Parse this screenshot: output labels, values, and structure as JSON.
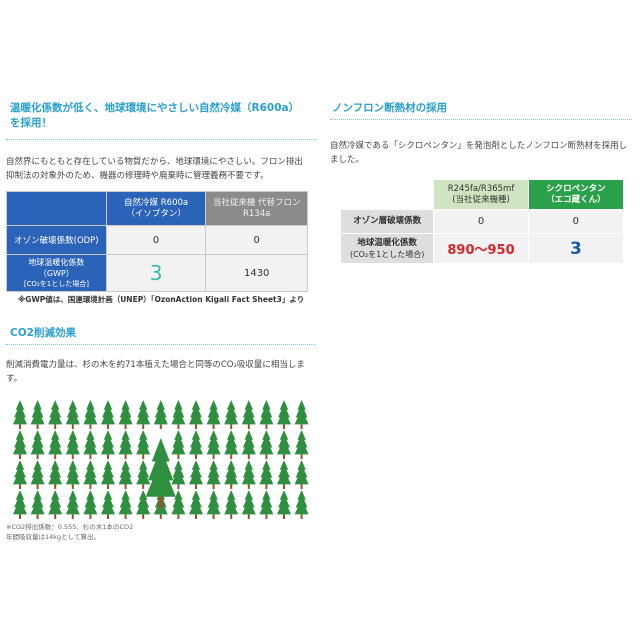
{
  "left": {
    "heading_line1": "温暖化係数が低く、地球環境にやさしい自然冷媒（R600a）",
    "heading_line2": "を採用！",
    "intro_line1": "自然界にもともと存在している物質だから、地球環境にやさしい。フロン排出",
    "intro_line2": "抑制法の対象外のため、機器の修理時や廃棄時に管理義務不要です。",
    "table": {
      "col1_line1": "自然冷媒 R600a",
      "col1_line2": "（イソブタン）",
      "col2_line1": "当社従来機 代替フロン",
      "col2_line2": "R134a",
      "row1_label": "オゾン破壊係数(ODP)",
      "row1_v1": "0",
      "row1_v2": "0",
      "row2_label_line1": "地球温暖化係数",
      "row2_label_line2": "（GWP）",
      "row2_label_line3": "[CO₂を1とした場合]",
      "row2_v1": "3",
      "row2_v2": "1430"
    },
    "gwp_note": "※GWP値は、国連環境計画（UNEP）「OzonAction Kigali Fact Sheet3」より",
    "co2_heading": "CO2削減効果",
    "co2_line1": "削減消費電力量は、杉の木を約71本植えた場合と同等のCO₂吸収量に相当しま",
    "co2_line2": "す。",
    "foot_line1": "※CO2排出係数：0.555、杉の木1本のCO2",
    "foot_line2": "年間吸収量は14kgとして算出。"
  },
  "right": {
    "heading": "ノンフロン断熱材の採用",
    "text_line1": "自然冷媒である「シクロペンタン」を発泡剤としたノンフロン断熱材を採用し",
    "text_line2": "ました。",
    "table": {
      "col1_line1": "R245fa/R365mf",
      "col1_line2": "(当社従来機種)",
      "col2_line1": "シクロペンタン",
      "col2_line2": "（エコ蔵くん）",
      "row1_label": "オゾン層破壊係数",
      "row1_v1": "0",
      "row1_v2": "0",
      "row2_label_line1": "地球温暖化係数",
      "row2_label_line2": "(CO₂を1とした場合)",
      "row2_v1": "890〜950",
      "row2_v2": "3"
    }
  },
  "colors": {
    "accent": "#2a9fd0",
    "table_blue": "#2b63b8",
    "tree_green": "#2e8f3e",
    "trunk": "#8a5a2b"
  },
  "trees": {
    "small_count": 68,
    "large_count": 1
  }
}
